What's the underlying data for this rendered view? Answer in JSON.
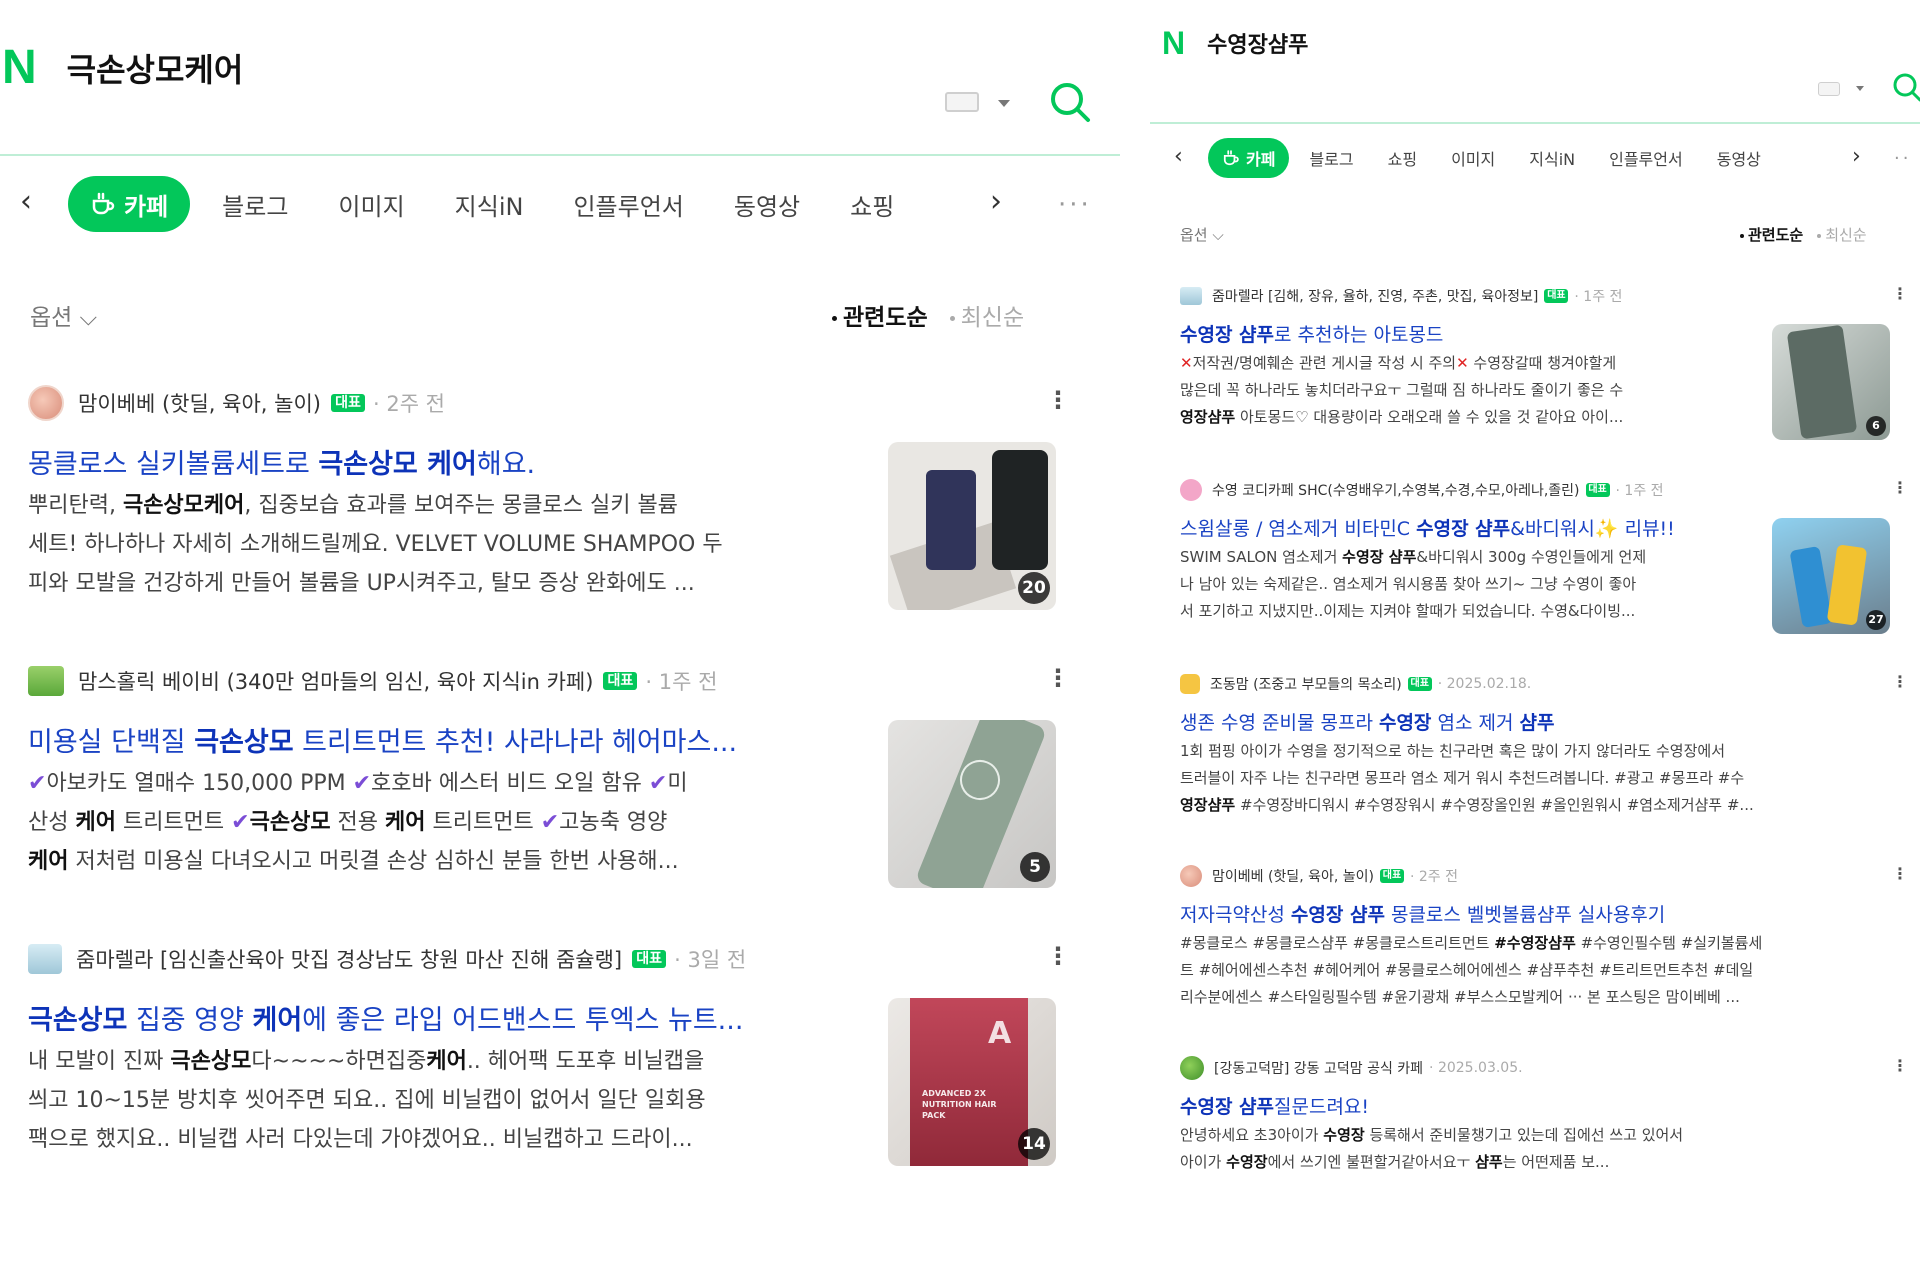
{
  "left": {
    "logo": "N",
    "query": "극손상모케어",
    "tabs": {
      "active": "카페",
      "items": [
        "블로그",
        "이미지",
        "지식iN",
        "인플루언서",
        "동영상",
        "쇼핑"
      ]
    },
    "options_label": "옵션",
    "sort": {
      "relevance": "관련도순",
      "latest": "최신순"
    },
    "results": [
      {
        "source": "맘이베베 (핫딜, 육아, 놀이)",
        "badge": "대표",
        "time": "2주 전",
        "title": {
          "a": "몽클로스 실키볼륨세트로 ",
          "b": "극손상모 케어",
          "c": "해요."
        },
        "snippet": {
          "s1": "뿌리탄력, ",
          "s2": "극손상모케어",
          "s3": ", 집중보습 효과를 보여주는 몽클로스 실키 볼륨",
          "s4": "세트! 하나하나 자세히 소개해드릴께요. VELVET VOLUME SHAMPOO 두",
          "s5": "피와 모발을 건강하게 만들어 볼륨을 UP시켜주고, 탈모 증상 완화에도 ..."
        },
        "thumb_count": "20",
        "thumb_colors": [
          "#e9e7e3",
          "#30345a",
          "#1f2324"
        ]
      },
      {
        "source": "맘스홀릭 베이비 (340만 엄마들의 임신, 육아 지식in 카페)",
        "badge": "대표",
        "time": "1주 전",
        "title": {
          "a": "미용실 단백질 ",
          "b": "극손상모",
          "c": " 트리트먼트 추천! 사라나라 헤어마스..."
        },
        "snippet": {
          "s1": "아보카도 열매수 150,000 PPM ",
          "s2": "호호바 에스터 비드 오일 함유 ",
          "s3": "미",
          "s4": "산성 ",
          "s5": "케어",
          "s6": " 트리트먼트 ",
          "s7": "극손상모",
          "s8": " 전용 ",
          "s9": "케어",
          "s10": " 트리트먼트 ",
          "s11": "고농축 영양",
          "s12": "케어",
          "s13": " 저처럼 미용실 다녀오시고 머릿결 손상 심하신 분들 한번 사용해..."
        },
        "thumb_count": "5",
        "thumb_colors": [
          "#d8d7d5",
          "#8fa394"
        ]
      },
      {
        "source": "줌마렐라 [임신출산육아 맛집 경상남도 창원 마산 진해 줌슐랭]",
        "badge": "대표",
        "time": "3일 전",
        "title": {
          "a": "극손상모",
          "b": " 집중 영양 ",
          "c": "케어",
          "d": "에 좋은 라입 어드밴스드 투엑스 뉴트..."
        },
        "snippet": {
          "s1": "내 모발이 진짜 ",
          "s2": "극손상모",
          "s3": "다~~~~하면집중",
          "s4": "케어",
          "s5": ".. 헤어팩 도포후 비닐캡을",
          "s6": "씌고 10~15분 방치후 씻어주면 되요.. 집에 비닐캡이 없어서 일단 일회용",
          "s7": "팩으로 했지요.. 비닐캡 사러 다있는데 가야겠어요.. 비닐캡하고 드라이..."
        },
        "thumb_count": "14",
        "thumb_colors": [
          "#c3485b",
          "#8e2838"
        ],
        "thumb_text": "ADVANCED 2X NUTRITION HAIR PACK"
      }
    ]
  },
  "right": {
    "logo": "N",
    "query": "수영장샴푸",
    "tabs": {
      "active": "카페",
      "items": [
        "블로그",
        "쇼핑",
        "이미지",
        "지식iN",
        "인플루언서",
        "동영상"
      ]
    },
    "options_label": "옵션",
    "sort": {
      "relevance": "관련도순",
      "latest": "최신순"
    },
    "results": [
      {
        "source": "줌마렐라 [김해, 장유, 율하, 진영, 주촌, 맛집, 육아정보]",
        "badge": "대표",
        "time": "1주 전",
        "title": {
          "a": "수영장 샴푸",
          "b": "로 추천하는 아토몽드"
        },
        "snippet": {
          "s1": "저작권/명예훼손 관련 게시글 작성 시 주의",
          "s2": " 수영장갈때 챙겨야할게",
          "s3": "많은데 꼭 하나라도 놓치더라구요ㅜ 그럴때 짐 하나라도 줄이기 좋은 수",
          "s4": "영장샴푸",
          "s5": " 아토몽드♡ 대용량이라 오래오래 쓸 수 있을 것 같아요 아이..."
        },
        "thumb_count": "6",
        "thumb_colors": [
          "#a7b2ad",
          "#5c6b64"
        ]
      },
      {
        "source": "수영 코디카페 SHC(수영배우기,수영복,수경,수모,아레나,졸린)",
        "badge": "대표",
        "time": "1주 전",
        "title": {
          "a": "스윔살롱 / 염소제거 비타민C ",
          "b": "수영장 샴푸",
          "c": "&바디워시",
          "d": "✨",
          "e": " 리뷰!!"
        },
        "snippet": {
          "s1": "SWIM SALON 염소제거 ",
          "s2": "수영장 샴푸",
          "s3": "&바디워시 300g 수영인들에게 언제",
          "s4": "나 남아 있는 숙제같은.. 염소제거 워시용품 찾아 쓰기~ 그냥 수영이 좋아",
          "s5": "서 포기하고 지냈지만..이제는 지켜야 할때가 되었습니다. 수영&다이빙..."
        },
        "thumb_count": "27",
        "thumb_colors": [
          "#4aa7d8",
          "#f2c230",
          "#4b6170"
        ]
      },
      {
        "source": "조동맘 (조중고 부모들의 목소리)",
        "badge": "대표",
        "time": "2025.02.18.",
        "title": {
          "a": "생존 수영 준비물 몽프라 ",
          "b": "수영장",
          "c": " 염소 제거 ",
          "d": "샴푸"
        },
        "snippet": {
          "s1": "1회 펌핑 아이가 수영을 정기적으로 하는 친구라면 혹은 많이 가지 않더라도 수영장에서",
          "s2": "트러블이 자주 나는 친구라면 몽프라 염소 제거 워시 추천드려봅니다. #광고 #몽프라 #수",
          "s3": "영장샴푸",
          "s4": " #수영장바디워시 #수영장워시 #수영장올인원 #올인원워시 #염소제거샴푸 #..."
        }
      },
      {
        "source": "맘이베베 (핫딜, 육아, 놀이)",
        "badge": "대표",
        "time": "2주 전",
        "title": {
          "a": "저자극약산성 ",
          "b": "수영장 샴푸",
          "c": " 몽클로스 벨벳볼륨샴푸 실사용후기"
        },
        "snippet": {
          "s1": "#몽클로스 #몽클로스샴푸 #몽클로스트리트먼트 ",
          "s2": "#수영장샴푸",
          "s3": " #수영인필수템 #실키볼륨세",
          "s4": "트 #헤어에센스추천 #헤어케어 #몽클로스헤어에센스 #샴푸추천 #트리트먼트추천 #데일",
          "s5": "리수분에센스 #스타일링필수템 #윤기광채 #부스스모발케어 ··· 본 포스팅은 맘이베베 ..."
        }
      },
      {
        "source": "[강동고덕맘] 강동 고덕맘 공식 카페",
        "time": "2025.03.05.",
        "title": {
          "a": "수영장 샴푸",
          "b": "질문드려요!"
        },
        "snippet": {
          "s1": "안녕하세요 초3아이가 ",
          "s2": "수영장",
          "s3": " 등록해서 준비물챙기고 있는데 집에선 쓰고 있어서",
          "s4": "아이가 ",
          "s5": "수영장",
          "s6": "에서 쓰기엔 불편할거같아서요ㅜ ",
          "s7": "샴푸",
          "s8": "는 어떤제품 보..."
        }
      }
    ]
  },
  "colors": {
    "accent": "#03c75a",
    "link": "#1a43c4",
    "check": "#7b4dd6"
  }
}
